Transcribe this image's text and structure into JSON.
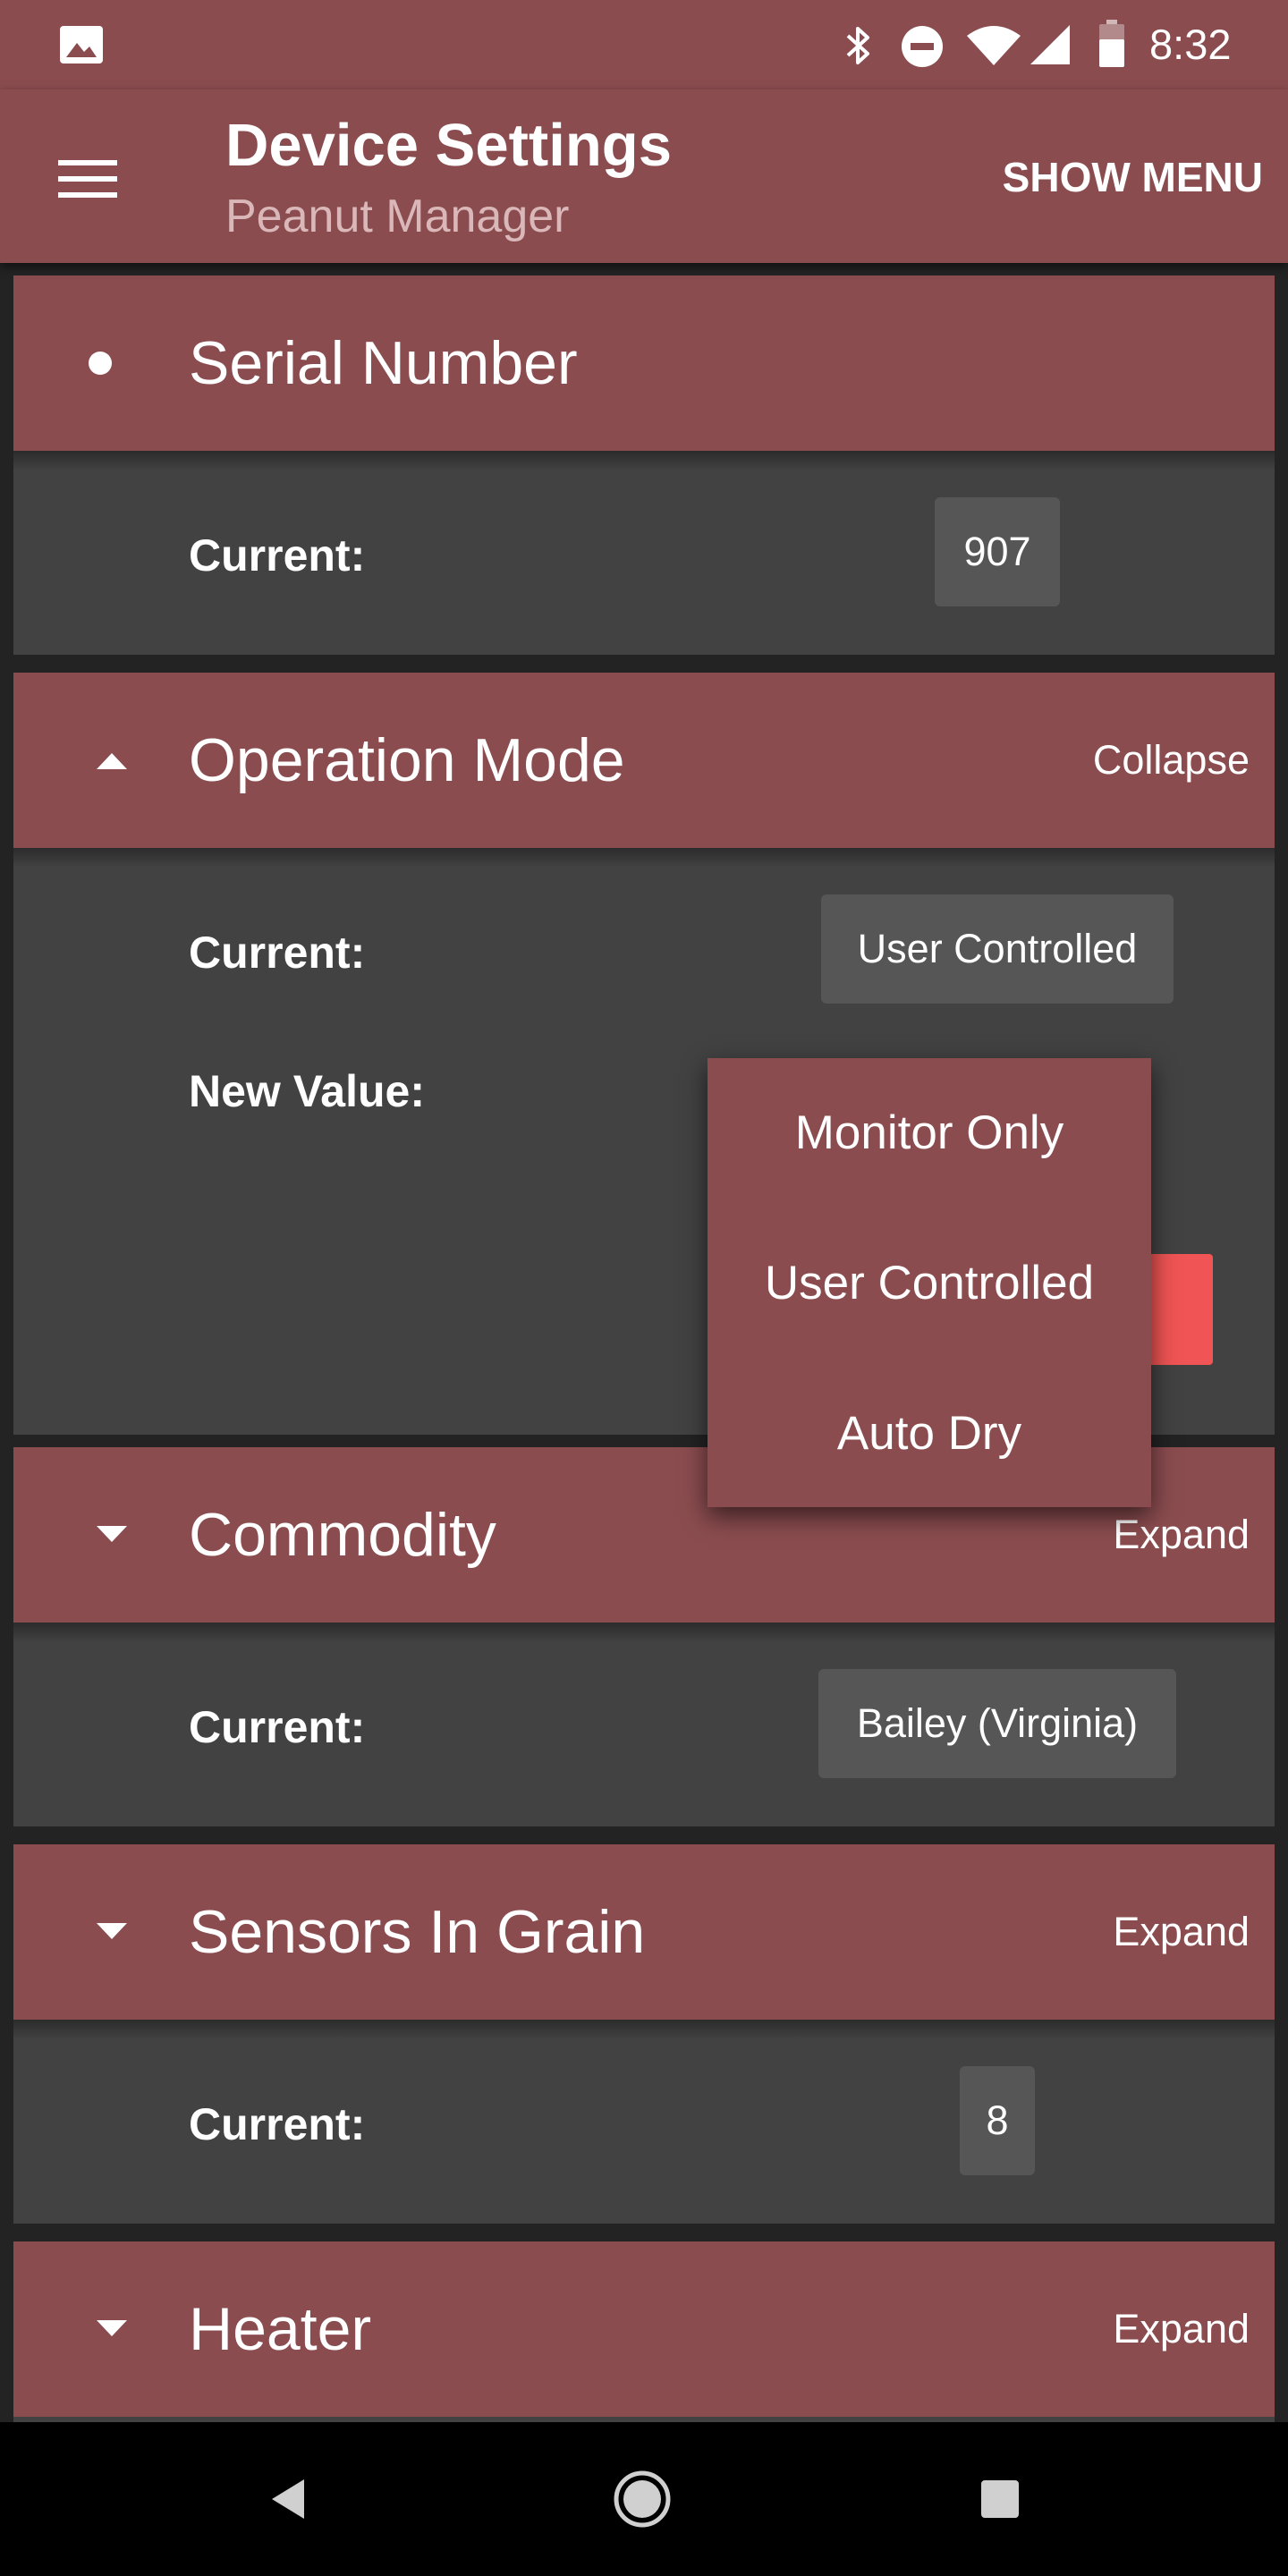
{
  "status_bar": {
    "time": "8:32",
    "icons": [
      "image-icon",
      "bluetooth-icon",
      "do-not-disturb-icon",
      "wifi-icon",
      "signal-icon",
      "battery-icon"
    ]
  },
  "app_bar": {
    "title": "Device Settings",
    "subtitle": "Peanut Manager",
    "menu_action": "SHOW MENU"
  },
  "sections": [
    {
      "title": "Serial Number",
      "action": "",
      "current_label": "Current:",
      "current_value": "907"
    },
    {
      "title": "Operation Mode",
      "action": "Collapse",
      "current_label": "Current:",
      "current_value": "User Controlled",
      "new_value_label": "New Value:"
    },
    {
      "title": "Commodity",
      "action": "Expand",
      "current_label": "Current:",
      "current_value": "Bailey (Virginia)"
    },
    {
      "title": "Sensors In Grain",
      "action": "Expand",
      "current_label": "Current:",
      "current_value": "8"
    },
    {
      "title": "Heater",
      "action": "Expand"
    }
  ],
  "dropdown": {
    "options": [
      "Monitor Only",
      "User Controlled",
      "Auto Dry"
    ]
  },
  "colors": {
    "primary": "#8a4c4f",
    "panel": "#424242",
    "chip": "#565656",
    "accent_button": "#f05454"
  }
}
